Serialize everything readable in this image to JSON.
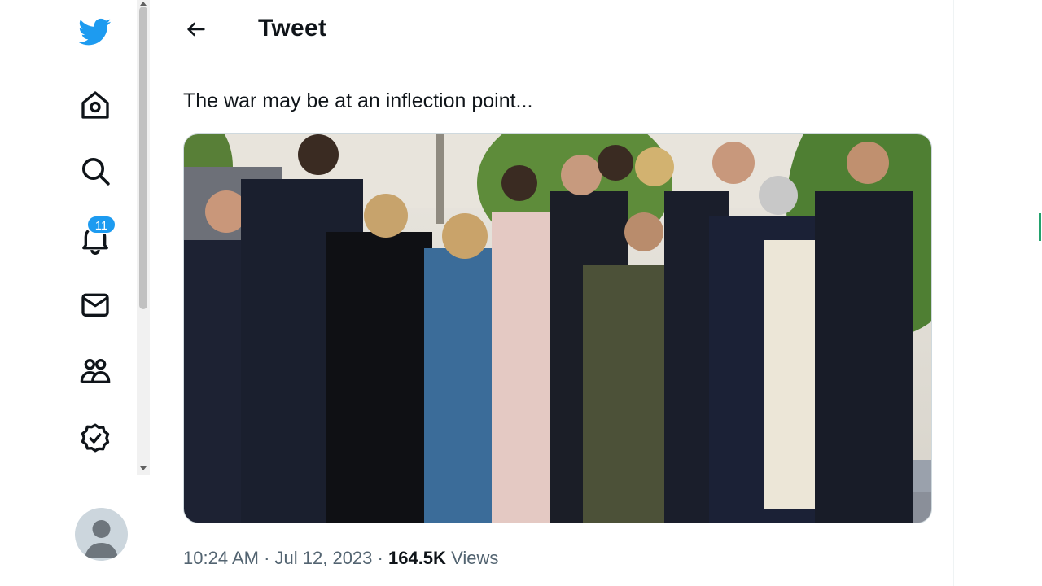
{
  "nav": {
    "items": [
      {
        "icon": "twitter-bird-icon"
      },
      {
        "icon": "home-icon"
      },
      {
        "icon": "search-icon"
      },
      {
        "icon": "bell-icon",
        "badge": "11"
      },
      {
        "icon": "mail-icon"
      },
      {
        "icon": "communities-icon"
      },
      {
        "icon": "verified-icon"
      }
    ],
    "accent": "#1d9bf0"
  },
  "header": {
    "title": "Tweet"
  },
  "tweet": {
    "text": "The war may be at an inflection point...",
    "time": "10:24 AM",
    "sep1": "·",
    "date": "Jul 12, 2023",
    "sep2": "·",
    "views_count": "164.5K",
    "views_label": "Views"
  },
  "colors": {
    "text": "#0f1419",
    "secondary": "#536471",
    "accent": "#1d9bf0"
  }
}
